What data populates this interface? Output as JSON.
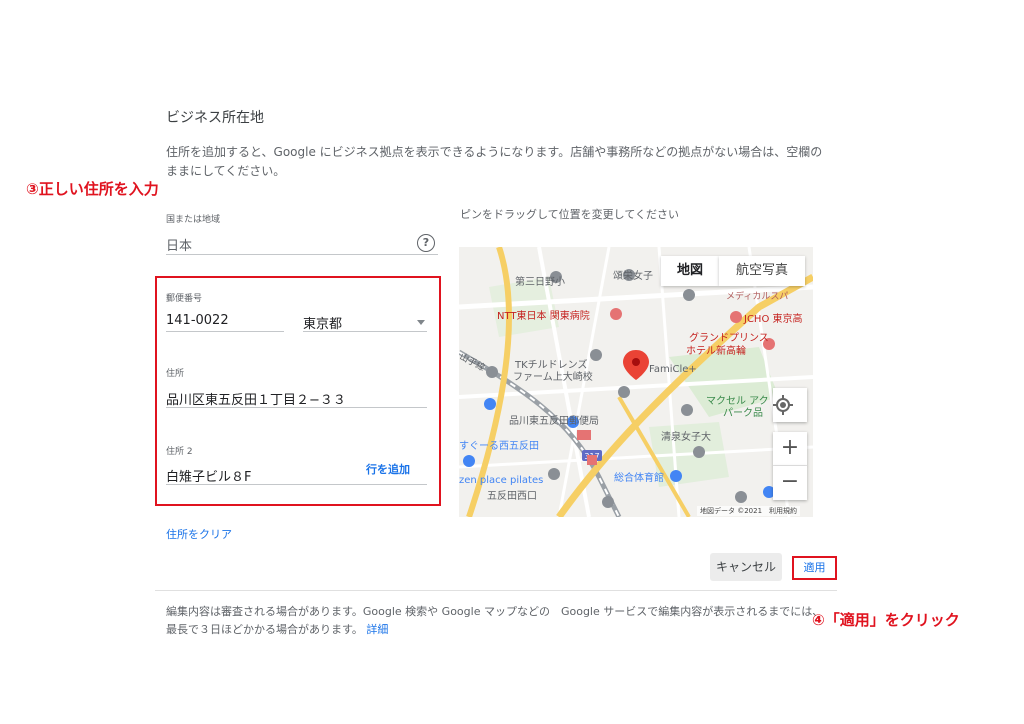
{
  "section": {
    "title": "ビジネス所在地",
    "description": "住所を追加すると、Google にビジネス拠点を表示できるようになります。店舗や事務所などの拠点がない場合は、空欄のままにしてください。"
  },
  "annotations": {
    "step3": "③正しい住所を入力",
    "step4": "④「適用」をクリック",
    "color": "#e0131f"
  },
  "form": {
    "country": {
      "label": "国または地域",
      "value": "日本"
    },
    "postal": {
      "label": "郵便番号",
      "value": "141-0022"
    },
    "prefecture": {
      "value": "東京都"
    },
    "address1": {
      "label": "住所",
      "value": "品川区東五反田１丁目２−３３"
    },
    "address2": {
      "label": "住所 2",
      "value": "白雉子ビル８F"
    },
    "add_line": "行を追加",
    "clear": "住所をクリア"
  },
  "map": {
    "hint": "ピンをドラッグして位置を変更してください",
    "type_map": "地図",
    "type_satellite": "航空写真",
    "zoom_in": "+",
    "zoom_out": "−",
    "footer": "地図データ ©2021　利用規約",
    "labels": {
      "school1": "第三日野小",
      "school2": "頌栄女子",
      "ntt": "NTT東日本 関東病院",
      "jcho": "JCHO 東京高",
      "grand1": "グランドプリンス",
      "grand2": "ホテル新高輪",
      "tk1": "TKチルドレンズ",
      "tk2": "ファーム上大崎校",
      "famicle": "FamiCle+",
      "makusel": "マクセル アク",
      "park": "パーク品",
      "post": "品川東五反田郵便局",
      "seisen": "清泉女子大",
      "sugura": "すぐーる西五反田",
      "sogo": "総合体育館",
      "zen": "zen place pilates",
      "nishi": "五反田西口",
      "yamanote": "山手線",
      "route": "317",
      "medical": "メディカルスパ"
    }
  },
  "actions": {
    "cancel": "キャンセル",
    "apply": "適用"
  },
  "notice": {
    "text": "編集内容は審査される場合があります。Google 検索や Google マップなどの　Google サービスで編集内容が表示されるまでには、最長で３日ほどかかる場合があります。",
    "details": "詳細"
  },
  "colors": {
    "accent": "#1a73e8",
    "highlight": "#e0131f",
    "pin": "#ea4335"
  }
}
